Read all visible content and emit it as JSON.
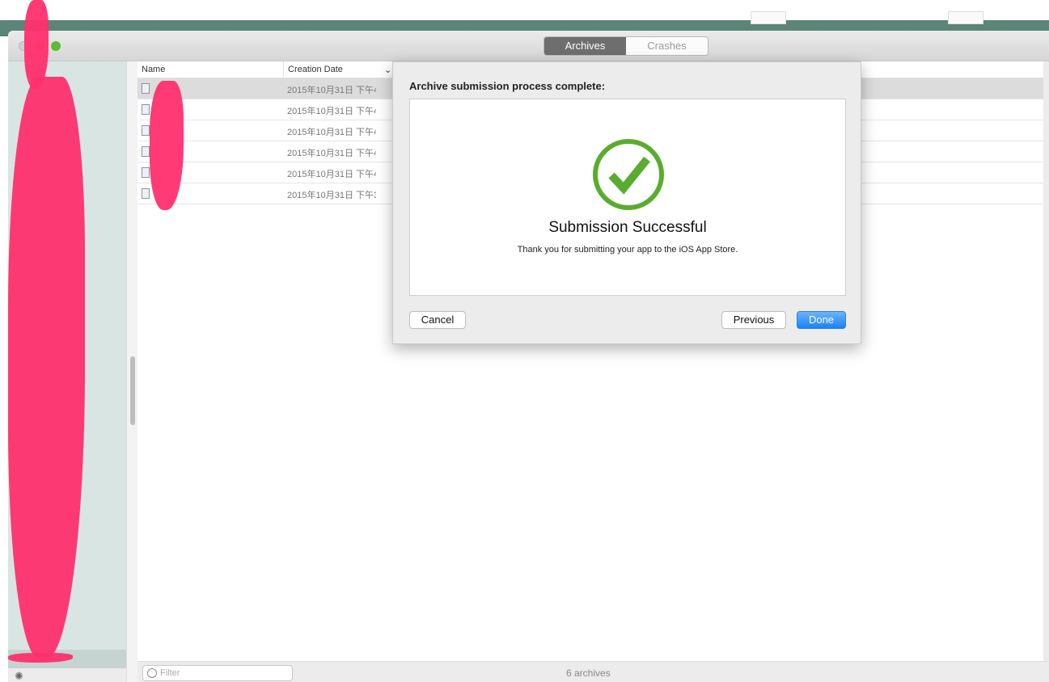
{
  "window": {
    "tabs": [
      {
        "label": "Archives",
        "active": true
      },
      {
        "label": "Crashes",
        "active": false
      }
    ]
  },
  "table": {
    "columns": [
      "Name",
      "Creation Date"
    ],
    "rows": [
      {
        "name": "",
        "date": "2015年10月31日 下午4"
      },
      {
        "name": "",
        "date": "2015年10月31日 下午4"
      },
      {
        "name": "",
        "date": "2015年10月31日 下午4"
      },
      {
        "name": "",
        "date": "2015年10月31日 下午4"
      },
      {
        "name": "",
        "date": "2015年10月31日 下午4"
      },
      {
        "name": "",
        "date": "2015年10月31日 下午3"
      }
    ],
    "selected_row": 0
  },
  "footer": {
    "filter_placeholder": "Filter",
    "count": "6 archives"
  },
  "dialog": {
    "title": "Archive submission process complete:",
    "heading": "Submission Successful",
    "message": "Thank you for submitting your app to the iOS App Store.",
    "cancel": "Cancel",
    "previous": "Previous",
    "done": "Done",
    "check_color": "#5aac2e"
  },
  "colors": {
    "redaction": "#ff2f6e",
    "accent": "#1a82fb"
  }
}
